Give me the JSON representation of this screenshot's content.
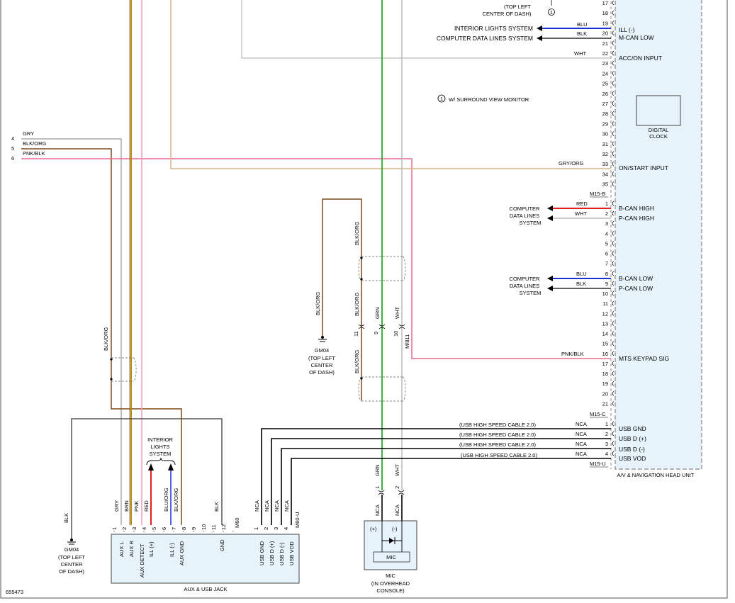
{
  "diagram_id": "655473",
  "head_unit": {
    "title": "A/V & NAVIGATION HEAD UNIT",
    "clock_label": [
      "DIGITAL",
      "CLOCK"
    ],
    "connector_b": "M15-B",
    "connector_c": "M15-C",
    "connector_u": "M15-U",
    "top_pins": [
      "17",
      "18",
      "19",
      "20",
      "21",
      "22",
      "23",
      "24",
      "25",
      "26",
      "27",
      "28",
      "29",
      "30",
      "31",
      "32",
      "33",
      "34",
      "35"
    ],
    "b_pins": [
      "1",
      "2",
      "3",
      "4",
      "5",
      "6",
      "7",
      "8",
      "9",
      "10",
      "11",
      "12",
      "13",
      "14",
      "15",
      "16",
      "17",
      "18",
      "19",
      "20",
      "21"
    ],
    "c_pins": [
      "1",
      "2",
      "3",
      "4"
    ],
    "functions": {
      "ill_minus": "ILL (-)",
      "mcan_low": "M-CAN LOW",
      "acc_on": "ACC/ON INPUT",
      "on_start": "ON/START INPUT",
      "bcan_high": "B-CAN HIGH",
      "pcan_high": "P-CAN HIGH",
      "bcan_low": "B-CAN LOW",
      "pcan_low": "P-CAN LOW",
      "mts_keypad": "MTS KEYPAD SIG",
      "usb_gnd": "USB GND",
      "usb_dp": "USB D (+)",
      "usb_dm": "USB D (-)",
      "usb_vod": "USB VOD"
    }
  },
  "systems": {
    "interior_lights": "INTERIOR LIGHTS SYSTEM",
    "computer_data_lines": "COMPUTER DATA LINES SYSTEM",
    "computer_data_lines_stacked": [
      "COMPUTER",
      "DATA LINES",
      "SYSTEM"
    ],
    "interior_lights_stacked": [
      "INTERIOR",
      "LIGHTS",
      "SYSTEM"
    ],
    "surround_note": "W/ SURROUND VIEW MONITOR",
    "note_marker": "1"
  },
  "wire_colors": {
    "blu": "BLU",
    "blk": "BLK",
    "wht": "WHT",
    "red": "RED",
    "gry": "GRY",
    "brn": "BRN",
    "pnk": "PNK",
    "grn": "GRN",
    "blk_org": "BLK/ORG",
    "pnk_blk": "PNK/BLK",
    "gry_org": "GRY/ORG",
    "blu_org": "BLU/ORG",
    "nca": "NCA"
  },
  "left_pins": [
    "4",
    "5",
    "6"
  ],
  "ground": {
    "name": "GM04",
    "location": [
      "(TOP LEFT",
      "CENTER",
      "OF DASH)"
    ],
    "location_mid": [
      "(TOP LEFT",
      "CENTER",
      "OF DASH)"
    ]
  },
  "top_ground_location": [
    "(TOP LEFT",
    "CENTER OF DASH)"
  ],
  "usb_cable": "(USB HIGH SPEED CABLE 2.0)",
  "connector_m811": "M/811",
  "m811_pins": {
    "a": "11",
    "b": "9",
    "c": "10"
  },
  "aux_jack": {
    "title": "AUX & USB JACK",
    "connector_a": "M60",
    "connector_b": "M60-U",
    "pins": [
      "1",
      "2",
      "3",
      "4",
      "5",
      "6",
      "7",
      "8",
      "9",
      "10",
      "11",
      "12"
    ],
    "u_pins": [
      "1",
      "2",
      "3",
      "4"
    ],
    "labels": {
      "aux_l": "AUX L",
      "aux_r": "AUX R",
      "aux_detect": "AUX DETECT",
      "ill_plus": "ILL (+)",
      "ill_minus": "ILL (-)",
      "aux_gnd": "AUX GND",
      "gnd": "GND",
      "usb_gnd": "USB GND",
      "usb_dp": "USB D (+)",
      "usb_dm": "USB D (-)",
      "usb_vod": "USB VOD"
    }
  },
  "mic": {
    "title": "MIC",
    "location": [
      "(IN OVERHEAD",
      "CONSOLE)"
    ],
    "plus": "(+)",
    "minus": "(-)",
    "pins": [
      "1",
      "2"
    ]
  },
  "colors": {
    "grn": "#2ca82c",
    "pnk": "#e86a8c",
    "brn": "#7a4a1e",
    "tan": "#d6b48c",
    "gry": "#aaaaaa",
    "blu": "#1a2fd6",
    "red": "#e02020",
    "box": "#e6f3fa"
  }
}
